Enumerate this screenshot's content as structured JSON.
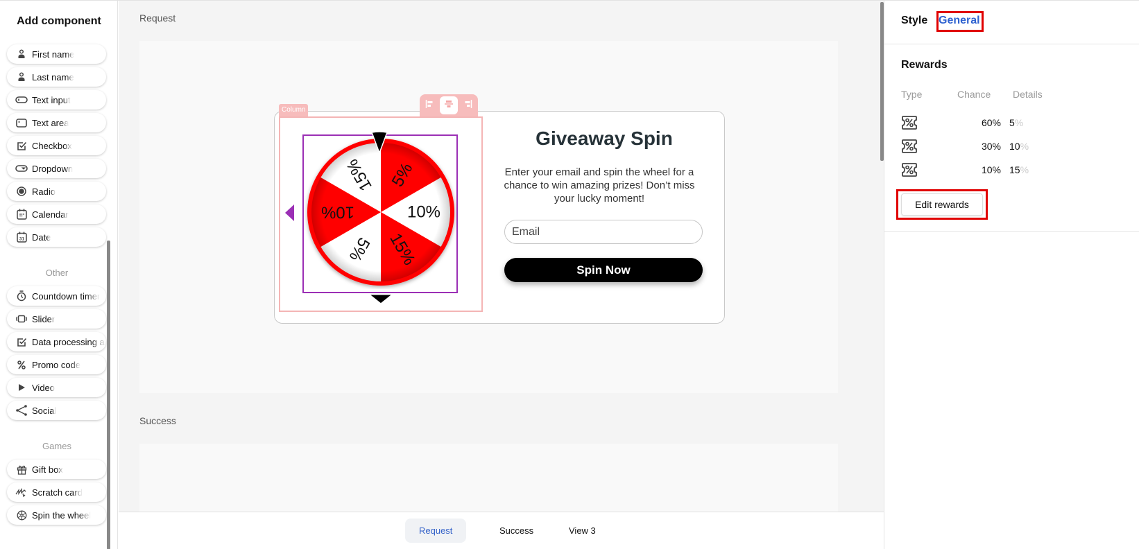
{
  "sidebar": {
    "title": "Add component",
    "components": [
      {
        "label": "First name",
        "icon": "person-icon"
      },
      {
        "label": "Last name",
        "icon": "person-icon"
      },
      {
        "label": "Text input",
        "icon": "text-input-icon"
      },
      {
        "label": "Text area",
        "icon": "text-area-icon"
      },
      {
        "label": "Checkbox",
        "icon": "checkbox-icon"
      },
      {
        "label": "Dropdown",
        "icon": "dropdown-icon"
      },
      {
        "label": "Radio",
        "icon": "radio-icon"
      },
      {
        "label": "Calendar",
        "icon": "calendar-icon"
      },
      {
        "label": "Date",
        "icon": "date-icon"
      }
    ],
    "other_label": "Other",
    "other": [
      {
        "label": "Countdown timer",
        "icon": "timer-icon"
      },
      {
        "label": "Slider",
        "icon": "slider-icon"
      },
      {
        "label": "Data processing agreement",
        "icon": "checkbox-icon"
      },
      {
        "label": "Promo code",
        "icon": "percent-icon"
      },
      {
        "label": "Video",
        "icon": "play-icon"
      },
      {
        "label": "Social",
        "icon": "share-icon"
      }
    ],
    "games_label": "Games",
    "games": [
      {
        "label": "Gift box",
        "icon": "gift-icon"
      },
      {
        "label": "Scratch card",
        "icon": "scratch-icon"
      },
      {
        "label": "Spin the wheel",
        "icon": "wheel-icon"
      }
    ]
  },
  "canvas": {
    "views": [
      {
        "label": "Request"
      },
      {
        "label": "Success"
      }
    ],
    "column_tag": "Column",
    "promo": {
      "title": "Giveaway Spin",
      "description": "Enter your email and spin the wheel for a chance to win amazing prizes! Don’t miss your lucky moment!",
      "email_placeholder": "Email",
      "button_label": "Spin Now"
    },
    "wheel": {
      "segments": [
        {
          "label": "5%",
          "color": "#ff0000"
        },
        {
          "label": "10%",
          "color": "#ffffff"
        },
        {
          "label": "15%",
          "color": "#ff0000"
        },
        {
          "label": "5%",
          "color": "#ffffff"
        },
        {
          "label": "10%",
          "color": "#ff0000"
        },
        {
          "label": "15%",
          "color": "#ffffff"
        }
      ],
      "rim_color": "#ff0000"
    }
  },
  "bottom_tabs": [
    {
      "label": "Request",
      "active": true
    },
    {
      "label": "Success",
      "active": false
    },
    {
      "label": "View 3",
      "active": false
    }
  ],
  "right_panel": {
    "tabs": [
      {
        "label": "Style"
      },
      {
        "label": "General"
      }
    ],
    "rewards_title": "Rewards",
    "columns": [
      "Type",
      "Chance",
      "Details"
    ],
    "rewards": [
      {
        "type": "discount-icon",
        "chance": "60%",
        "detail": "5",
        "unit": "%"
      },
      {
        "type": "discount-icon",
        "chance": "30%",
        "detail": "10",
        "unit": "%"
      },
      {
        "type": "discount-icon",
        "chance": "10%",
        "detail": "15",
        "unit": "%"
      }
    ],
    "edit_button": "Edit rewards"
  },
  "colors": {
    "accent": "#2f62d0",
    "highlight": "#e00000",
    "selection": "#9b2fb5",
    "column_outline": "#f4b5b5"
  }
}
